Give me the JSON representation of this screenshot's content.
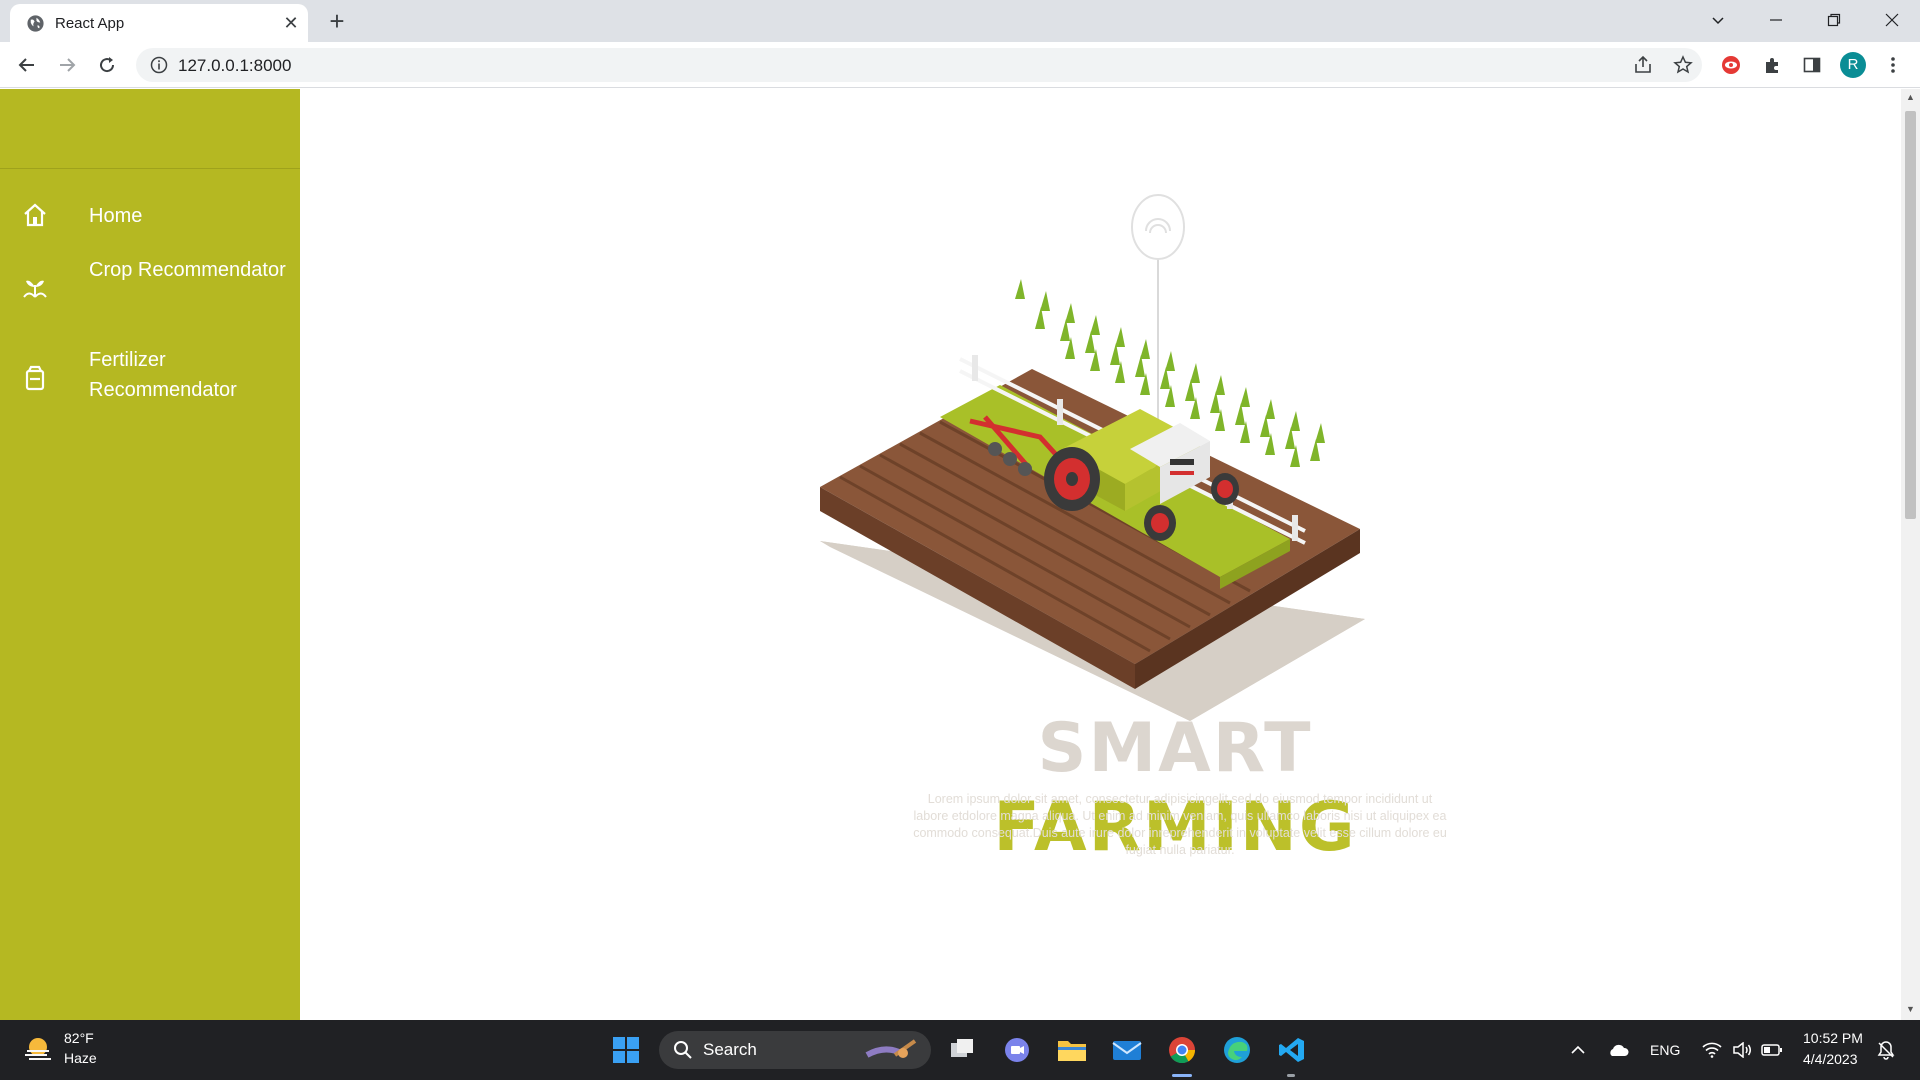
{
  "browser": {
    "tab_title": "React App",
    "url": "127.0.0.1:8000",
    "profile_initial": "R"
  },
  "sidebar": {
    "items": [
      {
        "label": "Home",
        "icon": "home-icon"
      },
      {
        "label": "Crop Recommendator",
        "icon": "sprout-icon"
      },
      {
        "label": "Fertilizer Recommendator",
        "icon": "fertilizer-bag-icon"
      }
    ]
  },
  "hero": {
    "title_part1": "SMART",
    "title_part2": "FARMING",
    "body": "Lorem ipsum dolor sit amet, consectetur adipisicingelit,sed do eiusmod tempor incididunt ut labore etdolore magna aliqua. Ut enim ad minim veniam, quis ullamco laboris nisi ut aliquipex ea commodo consequat.Duis aute irure dolor inreprehenderit in voluptate velit esse cillum dolore eu fugiat nulla pariatur."
  },
  "taskbar": {
    "weather_temp": "82°F",
    "weather_desc": "Haze",
    "search_label": "Search",
    "language": "ENG",
    "time": "10:52 PM",
    "date": "4/4/2023"
  },
  "colors": {
    "sidebar": "#b5b822",
    "accent": "#bcc02a",
    "soil": "#7a4b33",
    "grass": "#a9c028"
  }
}
